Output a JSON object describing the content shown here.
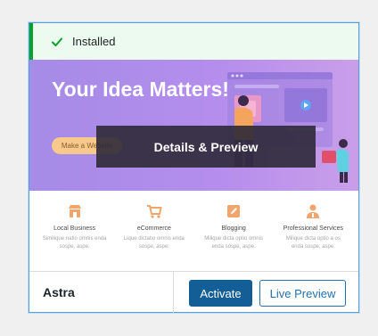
{
  "notice": {
    "text": "Installed",
    "icon": "checkmark-icon",
    "color": "#00a32a"
  },
  "screenshot": {
    "hero_title": "Your Idea Matters!",
    "hero_button": "Make a Website",
    "features": [
      {
        "icon": "store-icon",
        "title": "Local Business",
        "desc": "Similique natio omnis enda sospe, aspe."
      },
      {
        "icon": "cart-icon",
        "title": "eCommerce",
        "desc": "Lique dictatio omnis enda sospe, aspe."
      },
      {
        "icon": "pencil-icon",
        "title": "Blogging",
        "desc": "Milique dicta optio omnis enda sospe, aspe."
      },
      {
        "icon": "person-icon",
        "title": "Professional Services",
        "desc": "Milique dicta optio a os enda sospe, aspe."
      }
    ]
  },
  "overlay": {
    "label": "Details & Preview"
  },
  "footer": {
    "theme_name": "Astra",
    "activate_label": "Activate",
    "preview_label": "Live Preview"
  },
  "colors": {
    "primary_button": "#135e96",
    "secondary_button": "#2271b1",
    "notice_background": "#edfaef",
    "feature_icon": "#f0a56c"
  }
}
